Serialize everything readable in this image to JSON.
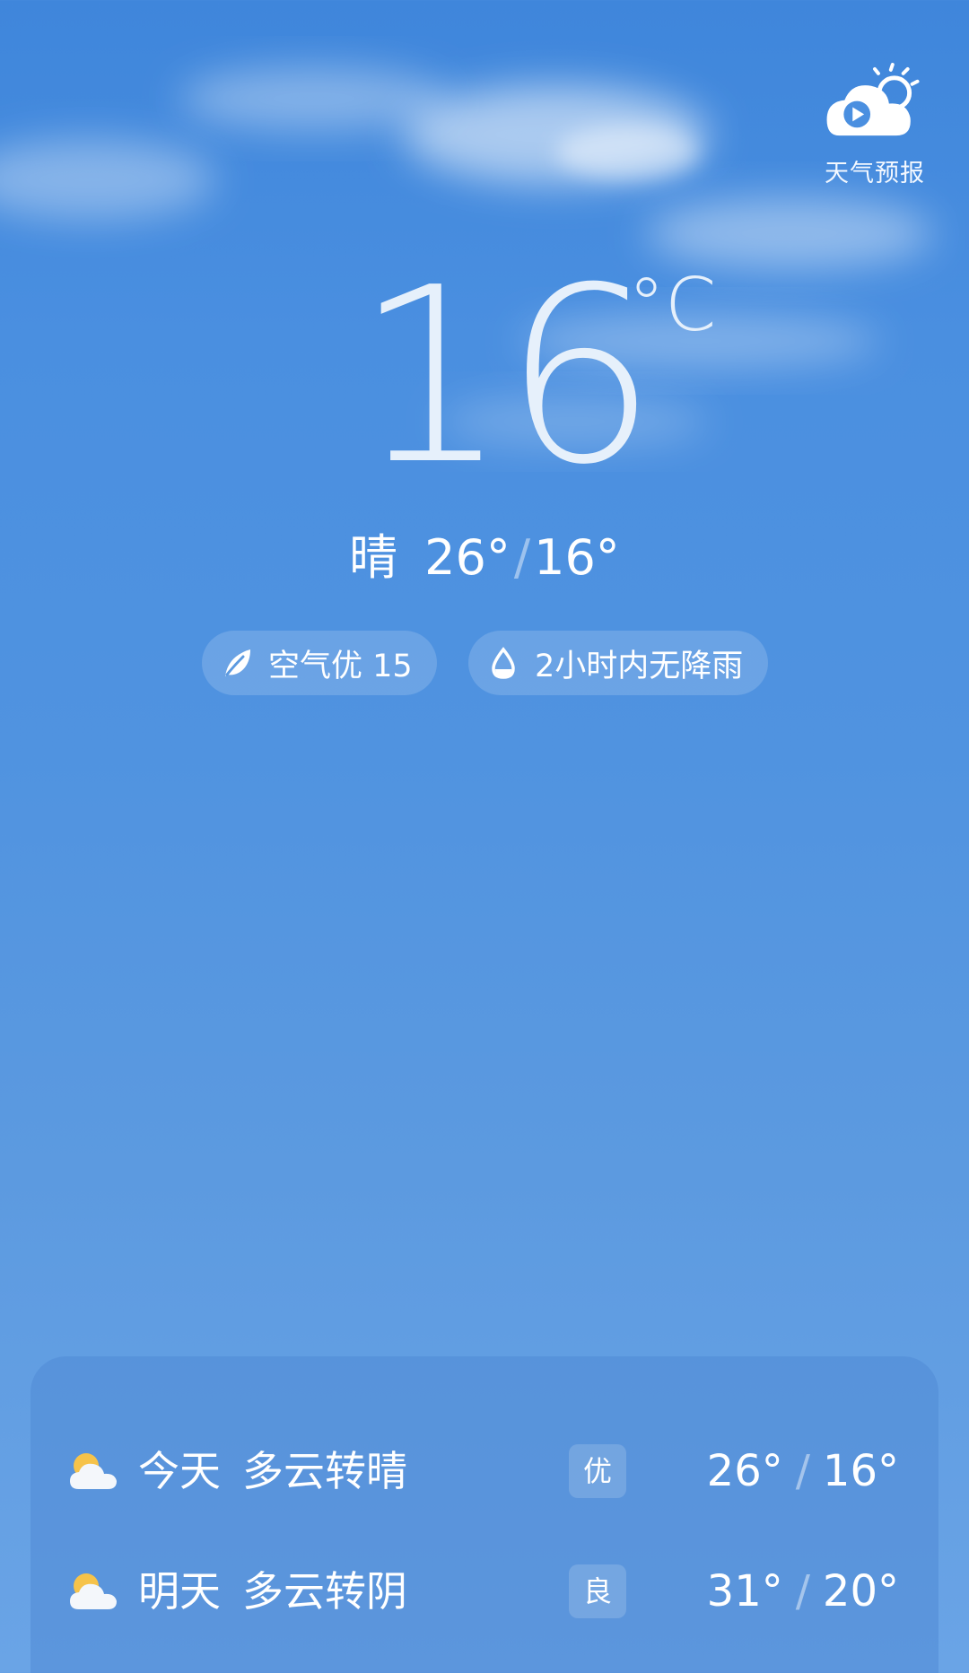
{
  "header": {
    "video_forecast_label": "天气预报"
  },
  "current": {
    "temperature": "16",
    "unit": "°C",
    "condition": "晴",
    "high": "26°",
    "low": "16°",
    "separator": "/"
  },
  "pills": {
    "air_quality": "空气优 15",
    "rain": "2小时内无降雨"
  },
  "forecast": [
    {
      "day": "今天",
      "desc": "多云转晴",
      "aqi": "优",
      "high": "26°",
      "low": "16°",
      "icon": "partly-cloudy-icon"
    },
    {
      "day": "明天",
      "desc": "多云转阴",
      "aqi": "良",
      "high": "31°",
      "low": "20°",
      "icon": "partly-cloudy-icon"
    }
  ],
  "colors": {
    "sky_top": "#3f86db",
    "sky_bottom": "#6aa4e6",
    "sun_yellow": "#f6c34a"
  }
}
